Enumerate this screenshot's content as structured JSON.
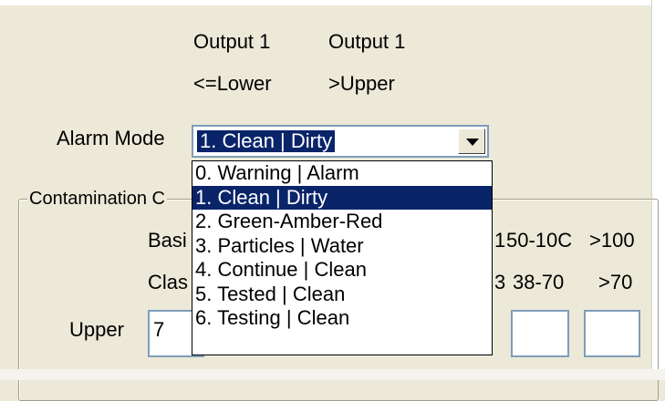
{
  "headers": {
    "col1_line1": "Output 1",
    "col1_line2": "<=Lower",
    "col2_line1": "Output 1",
    "col2_line2": ">Upper"
  },
  "alarm_mode": {
    "label": "Alarm Mode",
    "selected": "1. Clean | Dirty",
    "options": [
      "0. Warning | Alarm",
      "1. Clean | Dirty",
      "2. Green-Amber-Red",
      "3. Particles | Water",
      "4. Continue | Clean",
      "5. Tested | Clean",
      "6. Testing | Clean"
    ],
    "selected_index": 1
  },
  "contamination": {
    "group_label": "Contamination C",
    "basis_label": "Basi",
    "class_label": "Clas",
    "basis_values": [
      "50-10C",
      ">100"
    ],
    "class_values": [
      "38-70",
      ">70"
    ],
    "basis_partial": "1",
    "class_partial": "3"
  },
  "upper": {
    "label": "Upper",
    "value": "7"
  }
}
